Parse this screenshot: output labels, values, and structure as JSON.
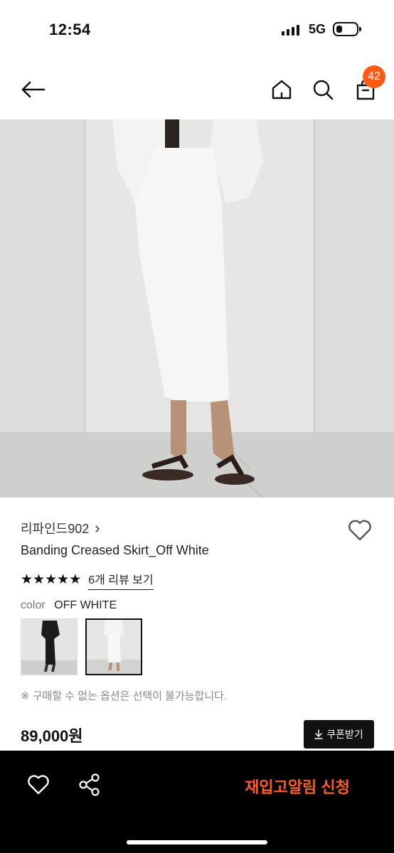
{
  "status_bar": {
    "time": "12:54",
    "network": "5G",
    "battery_level": 0.2
  },
  "header": {
    "cart_badge": "42"
  },
  "product": {
    "brand": "리파인드902",
    "brand_chevron": "›",
    "title": "Banding Creased Skirt_Off White",
    "rating_stars": 5,
    "review_link": "6개 리뷰 보기",
    "color_label": "color",
    "color_value": "OFF WHITE",
    "notice": "※ 구매할 수 없는 옵션은 선택이 불가능합니다.",
    "price": "89,000원"
  },
  "coupon_button": {
    "icon": "download-icon",
    "label": "쿠폰받기"
  },
  "bottom_bar": {
    "restock_label": "재입고알림 신청",
    "accent_color": "#ff5a2a"
  },
  "colors": {
    "badge": "#ff5a16",
    "bar_background": "#000000"
  }
}
